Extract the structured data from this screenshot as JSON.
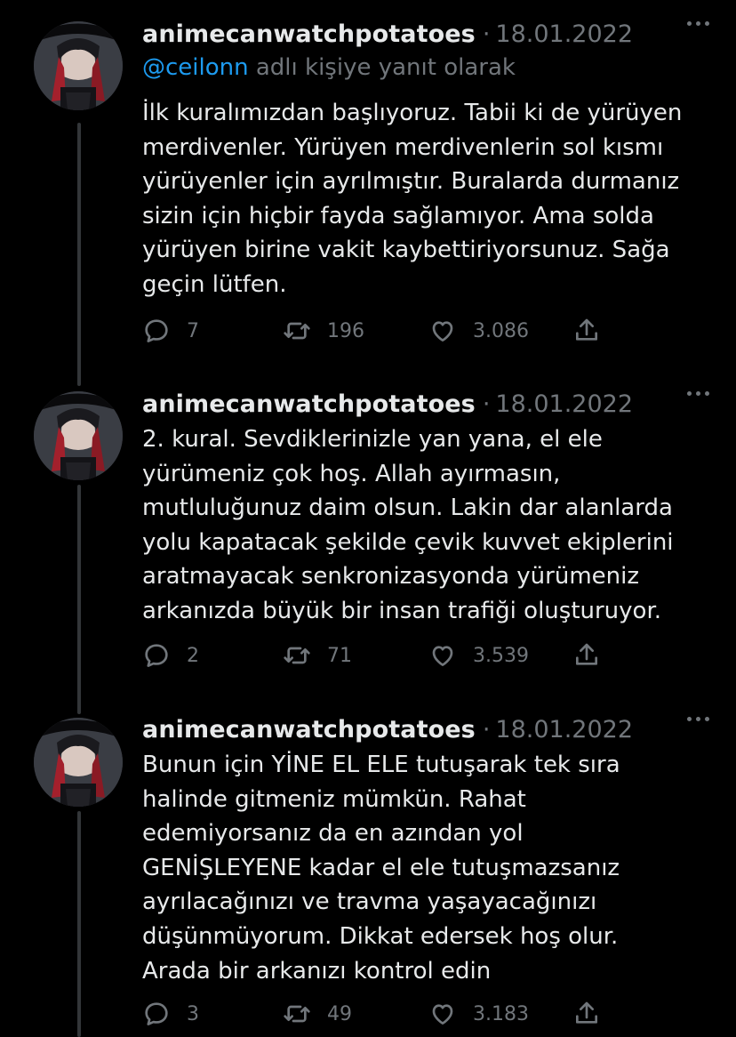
{
  "tweets": [
    {
      "username": "animecanwatchpotatoes",
      "date": "18.01.2022",
      "reply_handle": "@ceilonn",
      "reply_suffix": " adlı kişiye yanıt olarak",
      "text": "İlk kuralımızdan başlıyoruz. Tabii ki de yürüyen\nmerdivenler. Yürüyen merdivenlerin sol kısmı\nyürüyenler için ayrılmıştır. Buralarda durmanız\nsizin için hiçbir fayda sağlamıyor. Ama solda\nyürüyen birine vakit kaybettiriyorsunuz. Sağa\ngeçin lütfen.",
      "replies": "7",
      "retweets": "196",
      "likes": "3.086"
    },
    {
      "username": "animecanwatchpotatoes",
      "date": "18.01.2022",
      "text": "2. kural. Sevdiklerinizle yan yana, el ele\nyürümeniz çok hoş. Allah ayırmasın,\nmutluluğunuz daim olsun. Lakin dar alanlarda\nyolu kapatacak şekilde çevik kuvvet ekiplerini\naratmayacak senkronizasyonda yürümeniz\narkanızda büyük bir insan trafiği oluşturuyor.",
      "replies": "2",
      "retweets": "71",
      "likes": "3.539"
    },
    {
      "username": "animecanwatchpotatoes",
      "date": "18.01.2022",
      "text": "Bunun için YİNE EL ELE tutuşarak tek sıra\nhalinde gitmeniz mümkün. Rahat\nedemiyorsanız da en azından yol\nGENİŞLEYENE kadar el ele tutuşmazsanız\nayrılacağınızı ve travma yaşayacağınızı\ndüşünmüyorum. Dikkat edersek hoş olur.\nArada bir arkanızı kontrol edin",
      "replies": "3",
      "retweets": "49",
      "likes": "3.183"
    }
  ],
  "icons": {
    "reply": "reply-icon",
    "retweet": "retweet-icon",
    "like": "heart-icon",
    "share": "share-icon",
    "more": "more-icon"
  },
  "colors": {
    "background": "#000000",
    "text": "#e7e9ea",
    "muted": "#71767b",
    "link": "#1d9bf0",
    "thread_line": "#333639"
  }
}
